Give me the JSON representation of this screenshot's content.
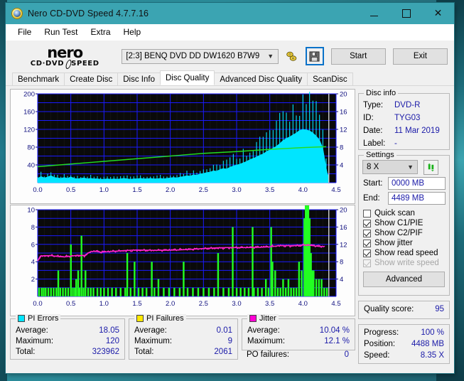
{
  "window": {
    "title": "Nero CD-DVD Speed 4.7.7.16",
    "icon": "nero-disc-icon",
    "minimize": "minimize-icon",
    "maximize": "maximize-icon",
    "close": "close-icon",
    "titlebar_color": "#3ba4b2"
  },
  "menu": {
    "items": [
      "File",
      "Run Test",
      "Extra",
      "Help"
    ]
  },
  "toolbar": {
    "logo_main": "nero",
    "logo_sub_left": "CD·DVD",
    "logo_sub_right": "SPEED",
    "drive": "[2:3]   BENQ DVD DD DW1620 B7W9",
    "drive_caret": "⌄",
    "eject_icon": "eject-disc-icon",
    "save_icon": "save-floppy-icon",
    "start_label": "Start",
    "exit_label": "Exit"
  },
  "tabs": {
    "items": [
      {
        "label": "Benchmark",
        "active": false
      },
      {
        "label": "Create Disc",
        "active": false
      },
      {
        "label": "Disc Info",
        "active": false
      },
      {
        "label": "Disc Quality",
        "active": true
      },
      {
        "label": "Advanced Disc Quality",
        "active": false
      },
      {
        "label": "ScanDisc",
        "active": false
      }
    ]
  },
  "disc_info": {
    "title": "Disc info",
    "rows": [
      {
        "key": "Type:",
        "value": "DVD-R"
      },
      {
        "key": "ID:",
        "value": "TYG03"
      },
      {
        "key": "Date:",
        "value": "11 Mar 2019"
      },
      {
        "key": "Label:",
        "value": "-"
      }
    ]
  },
  "settings": {
    "title": "Settings",
    "speed": "8 X",
    "speed_caret": "⌄",
    "refresh_icon": "refresh-arrows-icon",
    "start_label": "Start:",
    "start_value": "0000 MB",
    "end_label": "End:",
    "end_value": "4489 MB",
    "checks": [
      {
        "label": "Quick scan",
        "checked": false,
        "disabled": false
      },
      {
        "label": "Show C1/PIE",
        "checked": true,
        "disabled": false
      },
      {
        "label": "Show C2/PIF",
        "checked": true,
        "disabled": false
      },
      {
        "label": "Show jitter",
        "checked": true,
        "disabled": false
      },
      {
        "label": "Show read speed",
        "checked": true,
        "disabled": false
      },
      {
        "label": "Show write speed",
        "checked": true,
        "disabled": true
      }
    ],
    "advanced_label": "Advanced"
  },
  "quality": {
    "label": "Quality score:",
    "value": "95"
  },
  "status": {
    "rows": [
      {
        "key": "Progress:",
        "value": "100 %"
      },
      {
        "key": "Position:",
        "value": "4488 MB"
      },
      {
        "key": "Speed:",
        "value": "8.35 X"
      }
    ]
  },
  "stats": {
    "pi_errors": {
      "title": "PI Errors",
      "color": "#00e5ff",
      "rows": [
        {
          "key": "Average:",
          "value": "18.05"
        },
        {
          "key": "Maximum:",
          "value": "120"
        },
        {
          "key": "Total:",
          "value": "323962"
        }
      ]
    },
    "pi_failures": {
      "title": "PI Failures",
      "color": "#ffe800",
      "rows": [
        {
          "key": "Average:",
          "value": "0.01"
        },
        {
          "key": "Maximum:",
          "value": "9"
        },
        {
          "key": "Total:",
          "value": "2061"
        }
      ]
    },
    "jitter": {
      "title": "Jitter",
      "color": "#ff00d4",
      "rows": [
        {
          "key": "Average:",
          "value": "10.04 %"
        },
        {
          "key": "Maximum:",
          "value": "12.1 %"
        }
      ],
      "po_key": "PO failures:",
      "po_value": "0"
    }
  },
  "chart_data": [
    {
      "type": "area",
      "name": "pi-errors-chart",
      "title": "",
      "xlabel": "",
      "ylabel": "",
      "xlim": [
        0.0,
        4.5
      ],
      "ylim": [
        0,
        200
      ],
      "y2lim": [
        0,
        20
      ],
      "xticks": [
        "0.0",
        "0.5",
        "1.0",
        "1.5",
        "2.0",
        "2.5",
        "3.0",
        "3.5",
        "4.0",
        "4.5"
      ],
      "yticks": [
        "200",
        "160",
        "120",
        "80",
        "40"
      ],
      "y2ticks": [
        "20",
        "16",
        "12",
        "8",
        "4"
      ],
      "grid": true,
      "bg": "#0a0a0a",
      "gridcolor": "#1a1aff",
      "series": [
        {
          "name": "PI Errors",
          "kind": "area",
          "color": "#00e5ff",
          "axis": "left",
          "x": [
            0.0,
            0.05,
            0.1,
            0.15,
            0.2,
            0.25,
            0.3,
            0.35,
            0.4,
            0.45,
            0.5,
            0.55,
            0.6,
            0.65,
            0.7,
            0.75,
            0.8,
            0.85,
            0.9,
            0.95,
            1.0,
            1.05,
            1.1,
            1.15,
            1.2,
            1.25,
            1.3,
            1.35,
            1.4,
            1.45,
            1.5,
            1.55,
            1.6,
            1.65,
            1.7,
            1.75,
            1.8,
            1.85,
            1.9,
            1.95,
            2.0,
            2.05,
            2.1,
            2.15,
            2.2,
            2.25,
            2.3,
            2.35,
            2.4,
            2.45,
            2.5,
            2.55,
            2.6,
            2.65,
            2.7,
            2.75,
            2.8,
            2.85,
            2.9,
            2.95,
            3.0,
            3.05,
            3.1,
            3.15,
            3.2,
            3.25,
            3.3,
            3.35,
            3.4,
            3.45,
            3.5,
            3.55,
            3.6,
            3.65,
            3.7,
            3.75,
            3.8,
            3.85,
            3.9,
            3.95,
            4.0,
            4.05,
            4.1,
            4.15,
            4.2,
            4.25,
            4.3,
            4.35,
            4.38
          ],
          "y": [
            10,
            14,
            11,
            13,
            16,
            12,
            11,
            10,
            12,
            10,
            13,
            10,
            9,
            10,
            11,
            9,
            10,
            9,
            9,
            8,
            8,
            9,
            8,
            9,
            8,
            9,
            10,
            9,
            8,
            9,
            9,
            10,
            9,
            9,
            10,
            9,
            9,
            10,
            9,
            10,
            11,
            12,
            11,
            13,
            14,
            16,
            15,
            18,
            17,
            20,
            21,
            23,
            24,
            27,
            26,
            30,
            32,
            31,
            35,
            38,
            40,
            42,
            45,
            48,
            52,
            55,
            58,
            62,
            65,
            70,
            74,
            78,
            82,
            88,
            95,
            100,
            103,
            108,
            112,
            118,
            120,
            119,
            117,
            112,
            105,
            96,
            78,
            34,
            12
          ]
        },
        {
          "name": "Read speed",
          "kind": "line",
          "color": "#22dd22",
          "axis": "right",
          "x": [
            0.0,
            0.5,
            1.0,
            1.5,
            2.0,
            2.5,
            3.0,
            3.5,
            4.0,
            4.35
          ],
          "y": [
            3.6,
            4.2,
            4.8,
            5.4,
            6.0,
            6.6,
            7.0,
            7.5,
            7.9,
            8.1
          ]
        }
      ]
    },
    {
      "type": "bar",
      "name": "pi-failures-jitter-chart",
      "title": "",
      "xlabel": "",
      "ylabel": "",
      "xlim": [
        0.0,
        4.5
      ],
      "ylim": [
        0,
        10
      ],
      "y2lim": [
        0,
        20
      ],
      "xticks": [
        "0.0",
        "0.5",
        "1.0",
        "1.5",
        "2.0",
        "2.5",
        "3.0",
        "3.5",
        "4.0",
        "4.5"
      ],
      "yticks": [
        "10",
        "8",
        "6",
        "4",
        "2"
      ],
      "y2ticks": [
        "20",
        "16",
        "12",
        "8",
        "4"
      ],
      "grid": true,
      "bg": "#0a0a0a",
      "gridcolor": "#1a1aff",
      "series": [
        {
          "name": "PI Failures",
          "kind": "bar",
          "color": "#22ff22",
          "axis": "left",
          "x": [
            0.02,
            0.06,
            0.09,
            0.12,
            0.16,
            0.2,
            0.24,
            0.28,
            0.31,
            0.34,
            0.38,
            0.42,
            0.46,
            0.5,
            0.53,
            0.56,
            0.58,
            0.61,
            0.63,
            0.66,
            0.69,
            0.72,
            0.76,
            0.8,
            0.84,
            0.9,
            0.95,
            1.0,
            1.06,
            1.12,
            1.18,
            1.25,
            1.32,
            1.35,
            1.4,
            1.46,
            1.52,
            1.58,
            1.64,
            1.72,
            1.76,
            1.82,
            1.9,
            1.98,
            2.06,
            2.14,
            2.2,
            2.26,
            2.34,
            2.42,
            2.5,
            2.58,
            2.66,
            2.72,
            2.8,
            2.88,
            2.94,
            3.0,
            3.06,
            3.12,
            3.18,
            3.24,
            3.26,
            3.32,
            3.38,
            3.44,
            3.48,
            3.52,
            3.54,
            3.58,
            3.62,
            3.66,
            3.7,
            3.74,
            3.78,
            3.82,
            3.86,
            3.9,
            3.94,
            3.98,
            4.02,
            4.04,
            4.06,
            4.08,
            4.1,
            4.12,
            4.14,
            4.16,
            4.2,
            4.24,
            4.28,
            4.32,
            4.36
          ],
          "y": [
            1,
            1,
            1,
            1,
            1,
            1,
            1,
            1,
            3,
            1,
            1,
            1,
            1,
            6,
            1,
            1,
            2,
            3,
            1,
            7,
            1,
            3,
            1,
            1,
            1,
            1,
            1,
            1,
            1,
            1,
            1,
            1,
            1,
            5,
            1,
            4,
            1,
            1,
            1,
            4,
            1,
            2,
            1,
            1,
            1,
            1,
            4,
            1,
            1,
            1,
            1,
            1,
            1,
            5,
            1,
            1,
            8,
            1,
            1,
            1,
            1,
            8,
            1,
            1,
            1,
            2,
            1,
            8,
            4,
            3,
            1,
            1,
            2,
            1,
            2,
            1,
            1,
            1,
            4,
            3,
            9,
            13,
            18,
            12,
            9,
            5,
            3,
            3,
            2,
            2,
            2,
            1,
            1
          ]
        },
        {
          "name": "Jitter",
          "kind": "line",
          "color": "#ff22cc",
          "axis": "right",
          "x": [
            0.0,
            0.04,
            0.1,
            0.2,
            0.3,
            0.4,
            0.5,
            0.6,
            0.7,
            0.8,
            0.86,
            0.95,
            1.1,
            1.3,
            1.5,
            1.7,
            1.9,
            2.1,
            2.3,
            2.5,
            2.7,
            2.9,
            3.1,
            3.3,
            3.5,
            3.65,
            3.8,
            3.95,
            4.05,
            4.15,
            4.25,
            4.32
          ],
          "y": [
            8.2,
            9.2,
            9.3,
            9.4,
            9.3,
            9.2,
            9.3,
            9.4,
            9.3,
            10.3,
            10.5,
            10.3,
            10.4,
            10.5,
            10.6,
            10.6,
            10.7,
            10.8,
            10.9,
            11.0,
            11.1,
            11.2,
            11.3,
            11.4,
            11.5,
            11.7,
            11.6,
            11.7,
            11.9,
            11.8,
            11.6,
            11.5
          ]
        }
      ]
    }
  ]
}
